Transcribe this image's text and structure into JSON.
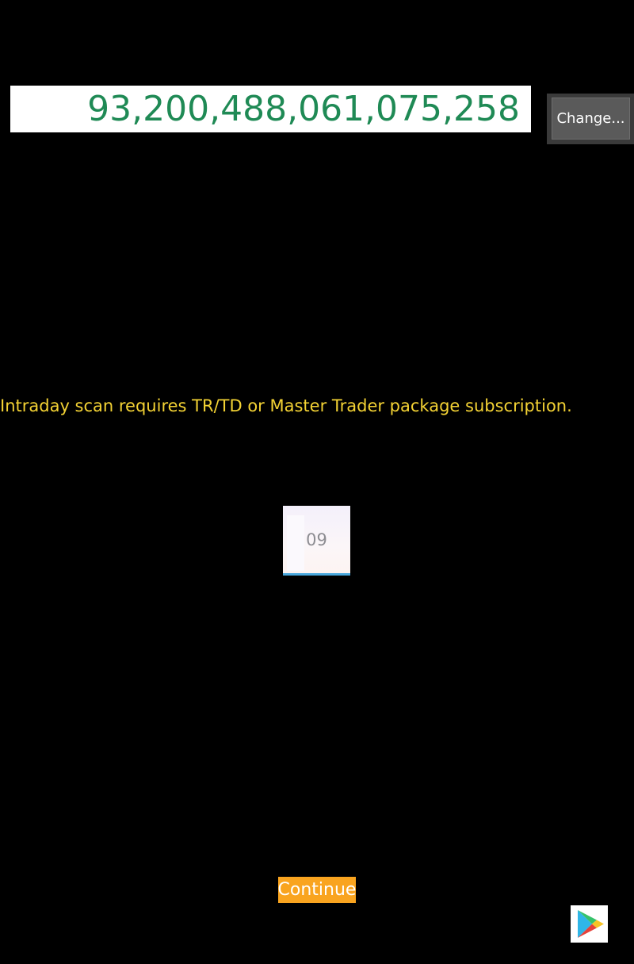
{
  "display": {
    "value": "93,200,488,061,075,258"
  },
  "buttons": {
    "change_label": "Change...",
    "continue_label": "Continue"
  },
  "message": {
    "text": "Intraday scan requires TR/TD or Master Trader package subscription."
  },
  "thumbnail": {
    "label": "09"
  },
  "icons": {
    "store": "play-store-icon"
  },
  "colors": {
    "background": "#000000",
    "number_text": "#1f8a55",
    "message_text": "#f3d234",
    "continue_bg": "#f9a41f",
    "thumb_accent": "#4aa8dd"
  }
}
